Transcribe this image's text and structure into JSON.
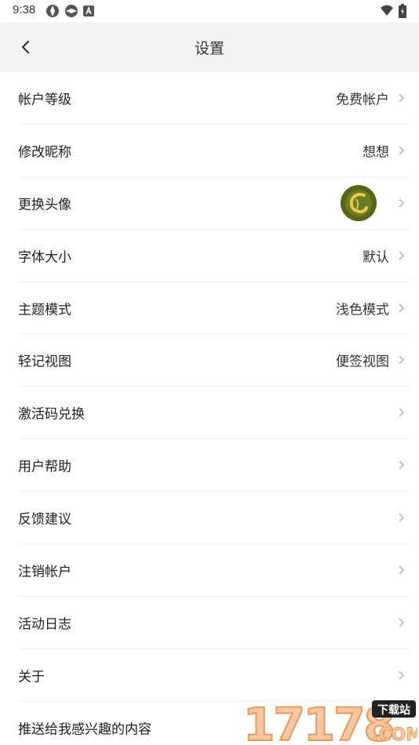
{
  "status": {
    "time": "9:38"
  },
  "header": {
    "title": "设置"
  },
  "settings": [
    {
      "label": "帐户等级",
      "value": "免费帐户"
    },
    {
      "label": "修改昵称",
      "value": "想想"
    },
    {
      "label": "更换头像",
      "value": ""
    },
    {
      "label": "字体大小",
      "value": "默认"
    },
    {
      "label": "主题模式",
      "value": "浅色模式"
    },
    {
      "label": "轻记视图",
      "value": "便签视图"
    },
    {
      "label": "激活码兑换",
      "value": ""
    },
    {
      "label": "用户帮助",
      "value": ""
    },
    {
      "label": "反馈建议",
      "value": ""
    },
    {
      "label": "注销帐户",
      "value": ""
    },
    {
      "label": "活动日志",
      "value": ""
    },
    {
      "label": "关于",
      "value": ""
    },
    {
      "label": "推送给我感兴趣的内容",
      "value": ""
    }
  ],
  "watermark": {
    "brand": "17178",
    "tld": ".COM",
    "badge": "下载站"
  },
  "colors": {
    "header_bg": "#f4f4f4",
    "divider": "#eeeeee",
    "chevron": "#bdbdbd",
    "watermark_orange": "#f0a05a"
  }
}
